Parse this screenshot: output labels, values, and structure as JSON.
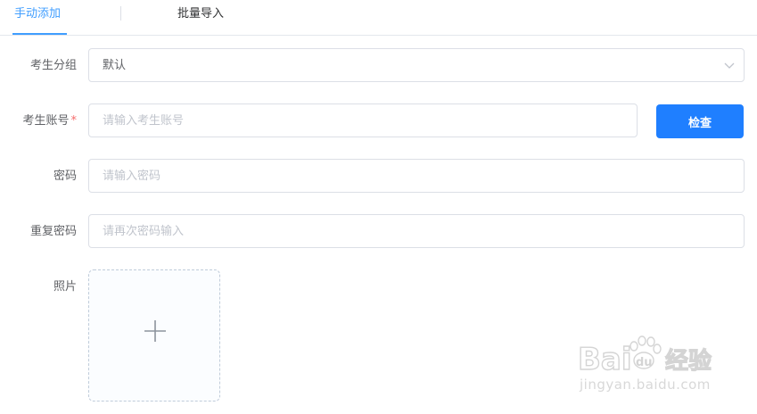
{
  "tabs": {
    "manual_label": "手动添加",
    "batch_label": "批量导入",
    "active": "manual"
  },
  "form": {
    "group": {
      "label": "考生分组",
      "value": "默认"
    },
    "account": {
      "label": "考生账号",
      "required_mark": "*",
      "placeholder": "请输入考生账号",
      "check_button": "检查"
    },
    "password": {
      "label": "密码",
      "placeholder": "请输入密码"
    },
    "repeat_password": {
      "label": "重复密码",
      "placeholder": "请再次密码输入"
    },
    "photo": {
      "label": "照片",
      "upload_icon": "plus-icon"
    }
  },
  "watermark": {
    "logo_text": "Bai du 经验",
    "url": "jingyan.baidu.com"
  },
  "colors": {
    "accent": "#409eff",
    "button": "#1f7fff",
    "required": "#f56c6c",
    "border": "#dcdfe6",
    "placeholder": "#c0c4cc"
  }
}
